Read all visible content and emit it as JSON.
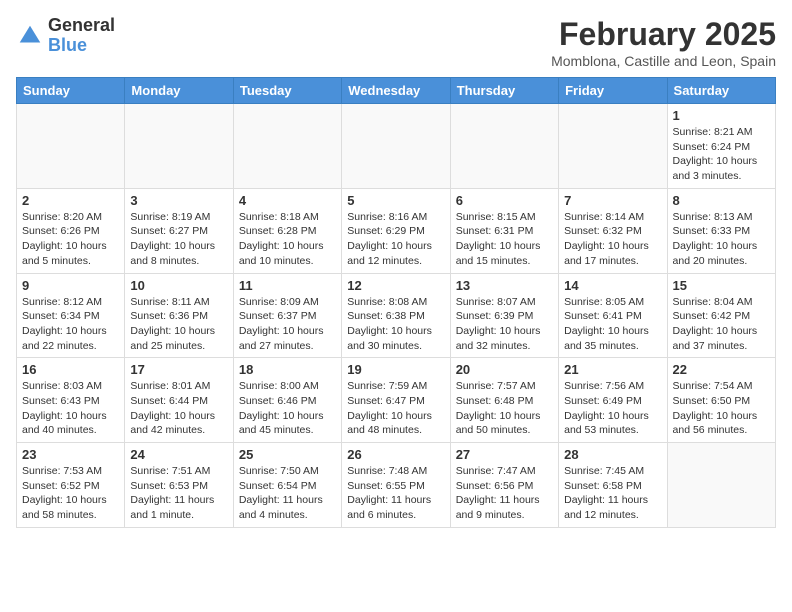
{
  "header": {
    "logo_general": "General",
    "logo_blue": "Blue",
    "month_title": "February 2025",
    "location": "Momblona, Castille and Leon, Spain"
  },
  "weekdays": [
    "Sunday",
    "Monday",
    "Tuesday",
    "Wednesday",
    "Thursday",
    "Friday",
    "Saturday"
  ],
  "weeks": [
    [
      {
        "day": "",
        "info": ""
      },
      {
        "day": "",
        "info": ""
      },
      {
        "day": "",
        "info": ""
      },
      {
        "day": "",
        "info": ""
      },
      {
        "day": "",
        "info": ""
      },
      {
        "day": "",
        "info": ""
      },
      {
        "day": "1",
        "info": "Sunrise: 8:21 AM\nSunset: 6:24 PM\nDaylight: 10 hours\nand 3 minutes."
      }
    ],
    [
      {
        "day": "2",
        "info": "Sunrise: 8:20 AM\nSunset: 6:26 PM\nDaylight: 10 hours\nand 5 minutes."
      },
      {
        "day": "3",
        "info": "Sunrise: 8:19 AM\nSunset: 6:27 PM\nDaylight: 10 hours\nand 8 minutes."
      },
      {
        "day": "4",
        "info": "Sunrise: 8:18 AM\nSunset: 6:28 PM\nDaylight: 10 hours\nand 10 minutes."
      },
      {
        "day": "5",
        "info": "Sunrise: 8:16 AM\nSunset: 6:29 PM\nDaylight: 10 hours\nand 12 minutes."
      },
      {
        "day": "6",
        "info": "Sunrise: 8:15 AM\nSunset: 6:31 PM\nDaylight: 10 hours\nand 15 minutes."
      },
      {
        "day": "7",
        "info": "Sunrise: 8:14 AM\nSunset: 6:32 PM\nDaylight: 10 hours\nand 17 minutes."
      },
      {
        "day": "8",
        "info": "Sunrise: 8:13 AM\nSunset: 6:33 PM\nDaylight: 10 hours\nand 20 minutes."
      }
    ],
    [
      {
        "day": "9",
        "info": "Sunrise: 8:12 AM\nSunset: 6:34 PM\nDaylight: 10 hours\nand 22 minutes."
      },
      {
        "day": "10",
        "info": "Sunrise: 8:11 AM\nSunset: 6:36 PM\nDaylight: 10 hours\nand 25 minutes."
      },
      {
        "day": "11",
        "info": "Sunrise: 8:09 AM\nSunset: 6:37 PM\nDaylight: 10 hours\nand 27 minutes."
      },
      {
        "day": "12",
        "info": "Sunrise: 8:08 AM\nSunset: 6:38 PM\nDaylight: 10 hours\nand 30 minutes."
      },
      {
        "day": "13",
        "info": "Sunrise: 8:07 AM\nSunset: 6:39 PM\nDaylight: 10 hours\nand 32 minutes."
      },
      {
        "day": "14",
        "info": "Sunrise: 8:05 AM\nSunset: 6:41 PM\nDaylight: 10 hours\nand 35 minutes."
      },
      {
        "day": "15",
        "info": "Sunrise: 8:04 AM\nSunset: 6:42 PM\nDaylight: 10 hours\nand 37 minutes."
      }
    ],
    [
      {
        "day": "16",
        "info": "Sunrise: 8:03 AM\nSunset: 6:43 PM\nDaylight: 10 hours\nand 40 minutes."
      },
      {
        "day": "17",
        "info": "Sunrise: 8:01 AM\nSunset: 6:44 PM\nDaylight: 10 hours\nand 42 minutes."
      },
      {
        "day": "18",
        "info": "Sunrise: 8:00 AM\nSunset: 6:46 PM\nDaylight: 10 hours\nand 45 minutes."
      },
      {
        "day": "19",
        "info": "Sunrise: 7:59 AM\nSunset: 6:47 PM\nDaylight: 10 hours\nand 48 minutes."
      },
      {
        "day": "20",
        "info": "Sunrise: 7:57 AM\nSunset: 6:48 PM\nDaylight: 10 hours\nand 50 minutes."
      },
      {
        "day": "21",
        "info": "Sunrise: 7:56 AM\nSunset: 6:49 PM\nDaylight: 10 hours\nand 53 minutes."
      },
      {
        "day": "22",
        "info": "Sunrise: 7:54 AM\nSunset: 6:50 PM\nDaylight: 10 hours\nand 56 minutes."
      }
    ],
    [
      {
        "day": "23",
        "info": "Sunrise: 7:53 AM\nSunset: 6:52 PM\nDaylight: 10 hours\nand 58 minutes."
      },
      {
        "day": "24",
        "info": "Sunrise: 7:51 AM\nSunset: 6:53 PM\nDaylight: 11 hours\nand 1 minute."
      },
      {
        "day": "25",
        "info": "Sunrise: 7:50 AM\nSunset: 6:54 PM\nDaylight: 11 hours\nand 4 minutes."
      },
      {
        "day": "26",
        "info": "Sunrise: 7:48 AM\nSunset: 6:55 PM\nDaylight: 11 hours\nand 6 minutes."
      },
      {
        "day": "27",
        "info": "Sunrise: 7:47 AM\nSunset: 6:56 PM\nDaylight: 11 hours\nand 9 minutes."
      },
      {
        "day": "28",
        "info": "Sunrise: 7:45 AM\nSunset: 6:58 PM\nDaylight: 11 hours\nand 12 minutes."
      },
      {
        "day": "",
        "info": ""
      }
    ]
  ]
}
